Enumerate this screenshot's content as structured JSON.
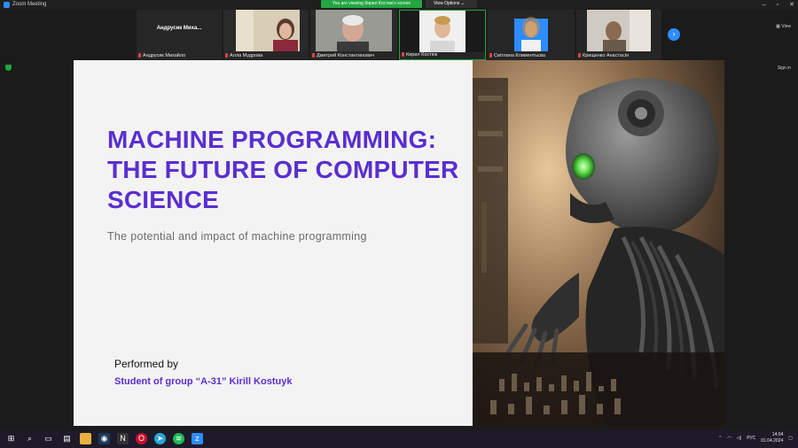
{
  "window": {
    "title": "Zoom Meeting",
    "share_banner": "You are viewing Кирил Костюк's screen",
    "view_options": "View Options",
    "view_button": "View",
    "sign_in": "Sign in"
  },
  "participants": [
    {
      "name": "Андрусик Михайло",
      "display": "Андрусик Миха..."
    },
    {
      "name": "Алла Мудрова"
    },
    {
      "name": "Дмитрий Константинович"
    },
    {
      "name": "Кирил Костюк"
    },
    {
      "name": "Світлана Климентьєва"
    },
    {
      "name": "Крищенко Анастасія"
    }
  ],
  "slide": {
    "title_line1": "MACHINE PROGRAMMING:",
    "title_line2": "THE FUTURE OF COMPUTER",
    "title_line3": "SCIENCE",
    "subtitle": "The potential and impact of machine programming",
    "performed_by": "Performed by",
    "student": "Student of group “A-31” Kirill Kostuyk"
  },
  "taskbar": {
    "language": "РУС",
    "time": "14:04",
    "date": "01.04.2024"
  },
  "colors": {
    "accent": "#5a2fd0",
    "zoom_blue": "#2d8cff",
    "banner_green": "#23a542"
  }
}
